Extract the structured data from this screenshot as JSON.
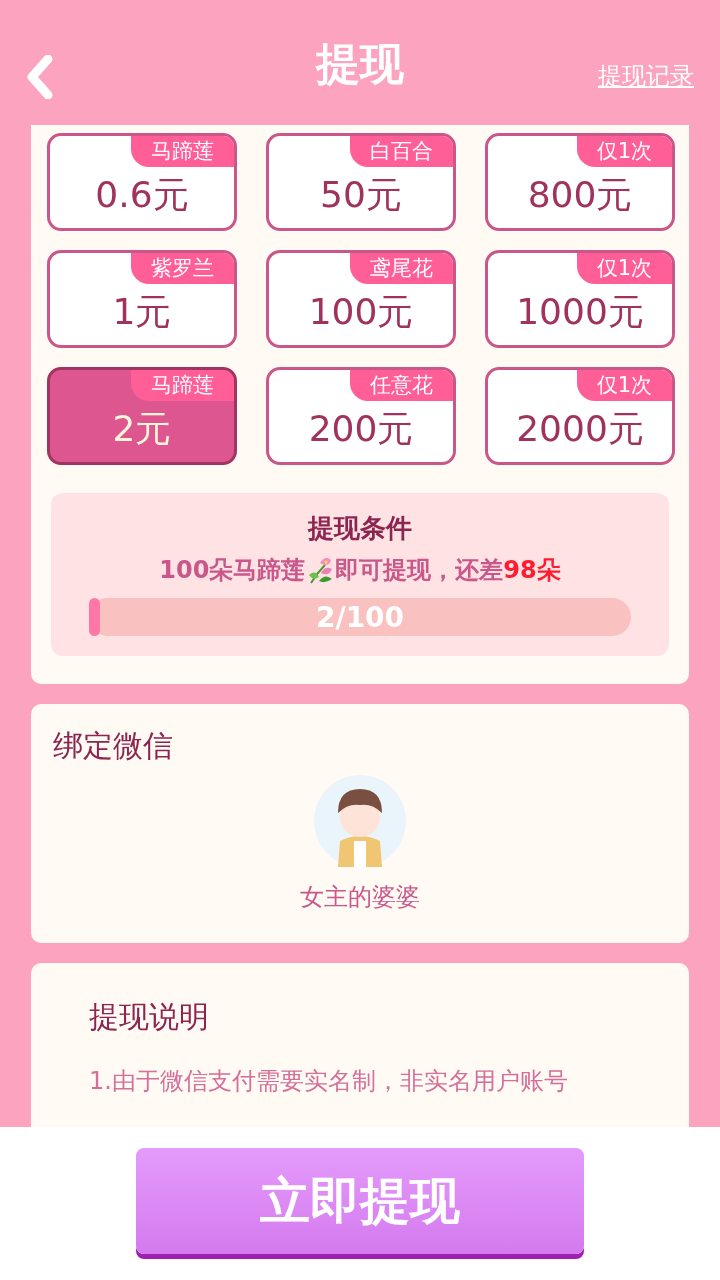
{
  "header": {
    "title": "提现",
    "link": "提现记录"
  },
  "options": [
    {
      "tag": "马蹄莲",
      "amount": "0.6元",
      "selected": false
    },
    {
      "tag": "白百合",
      "amount": "50元",
      "selected": false
    },
    {
      "tag": "仅1次",
      "amount": "800元",
      "selected": false
    },
    {
      "tag": "紫罗兰",
      "amount": "1元",
      "selected": false
    },
    {
      "tag": "鸢尾花",
      "amount": "100元",
      "selected": false
    },
    {
      "tag": "仅1次",
      "amount": "1000元",
      "selected": false
    },
    {
      "tag": "马蹄莲",
      "amount": "2元",
      "selected": true
    },
    {
      "tag": "任意花",
      "amount": "200元",
      "selected": false
    },
    {
      "tag": "仅1次",
      "amount": "2000元",
      "selected": false
    }
  ],
  "condition": {
    "title": "提现条件",
    "text_start": "100朵马蹄莲",
    "text_end": "即可提现，还差",
    "shortfall": "98朵",
    "progress": {
      "level": 0.02,
      "reading": "2/100"
    }
  },
  "wechat": {
    "title": "绑定微信",
    "name": "女主的婆婆"
  },
  "notes": {
    "title": "提现说明",
    "paragraph": "1.由于微信支付需要实名制，非实名用户账号"
  },
  "submit": "立即提现"
}
